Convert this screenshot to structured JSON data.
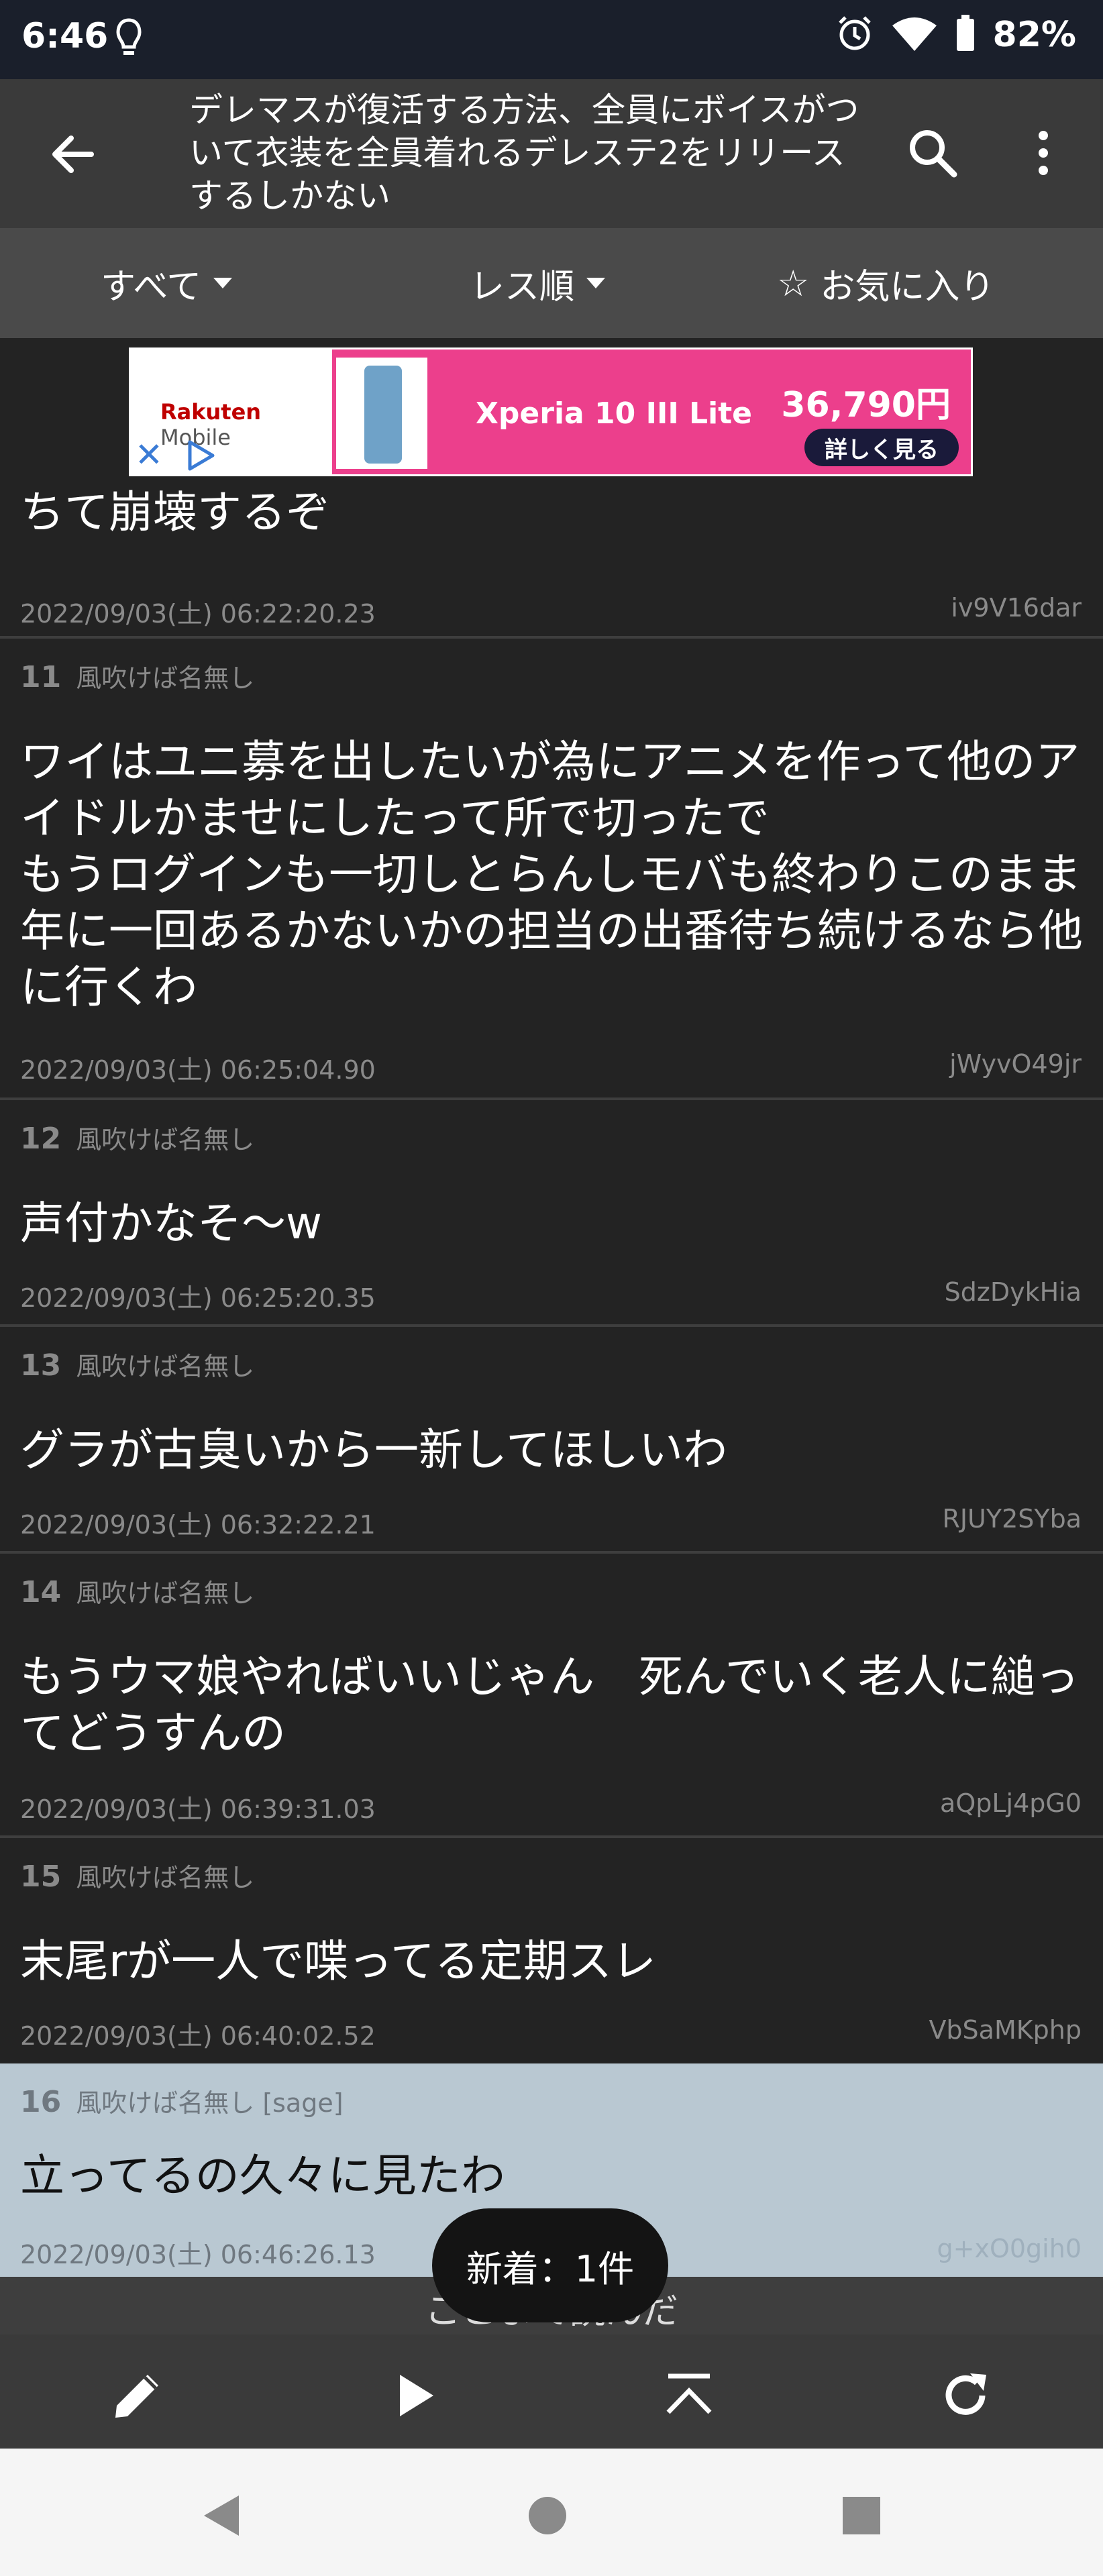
{
  "status_bar": {
    "time": "6:46",
    "battery": "82%"
  },
  "app_bar": {
    "title": "デレマスが復活する方法、全員にボイスがついて衣装を全員着れるデレステ2をリリースするしかない"
  },
  "tabs": [
    {
      "label": "すべて"
    },
    {
      "label": "レス順"
    },
    {
      "label": "お気に入り"
    }
  ],
  "ad": {
    "brand_a": "Rakuten",
    "brand_b": " Mobile",
    "product": "Xperia 10 III Lite",
    "price": "36,790円",
    "cta": "詳しく見る"
  },
  "partial_post": {
    "body": "ちて崩壊するぞ",
    "date": "2022/09/03(土) 06:22:20.23",
    "id": "iv9V16dar"
  },
  "posts": [
    {
      "num": "11",
      "name": "風吹けば名無し",
      "body": "ワイはユニ募を出したいが為にアニメを作って他のアイドルかませにしたって所で切ったで\nもうログインも一切しとらんしモバも終わりこのまま年に一回あるかないかの担当の出番待ち続けるなら他に行くわ",
      "date": "2022/09/03(土) 06:25:04.90",
      "id": "jWyvO49jr"
    },
    {
      "num": "12",
      "name": "風吹けば名無し",
      "body": "声付かなそ〜w",
      "date": "2022/09/03(土) 06:25:20.35",
      "id": "SdzDykHia"
    },
    {
      "num": "13",
      "name": "風吹けば名無し",
      "body": "グラが古臭いから一新してほしいわ",
      "date": "2022/09/03(土) 06:32:22.21",
      "id": "RJUY2SYba"
    },
    {
      "num": "14",
      "name": "風吹けば名無し",
      "body": "もうウマ娘やればいいじゃん　死んでいく老人に縋ってどうすんの",
      "date": "2022/09/03(土) 06:39:31.03",
      "id": "aQpLj4pG0"
    },
    {
      "num": "15",
      "name": "風吹けば名無し",
      "body": "末尾rが一人で喋ってる定期スレ",
      "date": "2022/09/03(土) 06:40:02.52",
      "id": "VbSaMKphp"
    },
    {
      "num": "16",
      "name": "風吹けば名無し [sage]",
      "body": "立ってるの久々に見たわ",
      "date": "2022/09/03(土) 06:46:26.13",
      "id": "g+xO0gih0"
    }
  ],
  "toast": "新着：1件",
  "under_text": "ここまで読んだ"
}
